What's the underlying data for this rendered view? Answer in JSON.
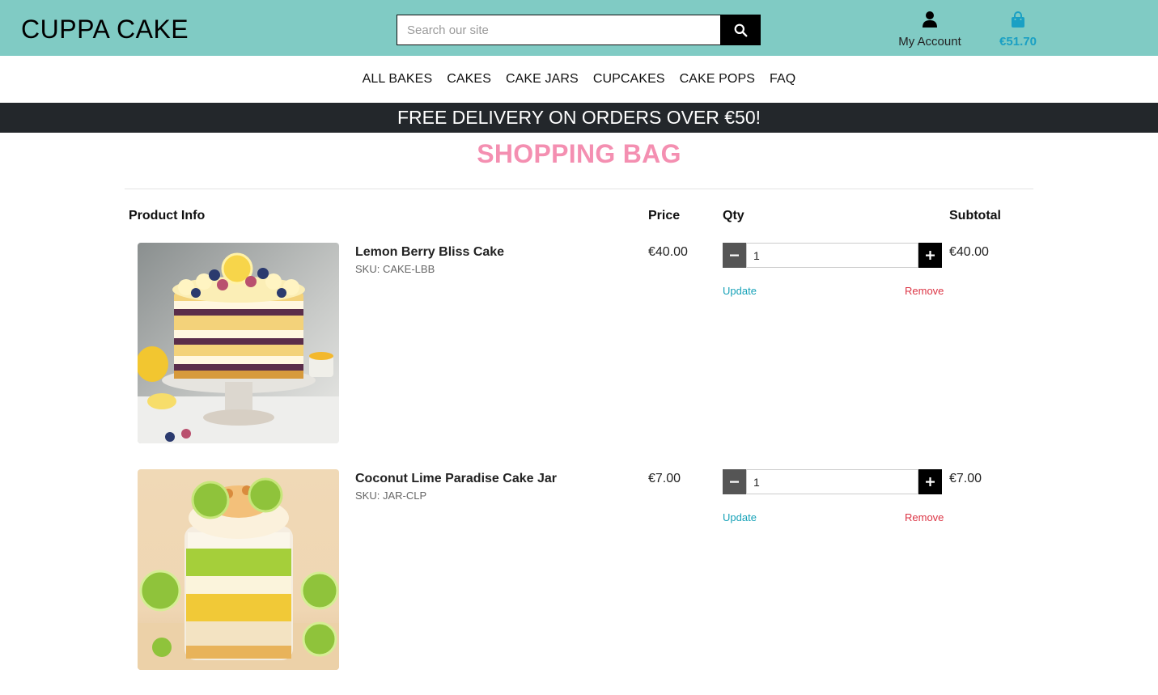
{
  "header": {
    "logo": "CUPPA CAKE",
    "search_placeholder": "Search our site",
    "account_label": "My Account",
    "bag_total": "€51.70"
  },
  "nav": {
    "items": [
      "ALL BAKES",
      "CAKES",
      "CAKE JARS",
      "CUPCAKES",
      "CAKE POPS",
      "FAQ"
    ]
  },
  "banner": {
    "text": "FREE DELIVERY ON ORDERS OVER €50!"
  },
  "page": {
    "title": "SHOPPING BAG"
  },
  "table": {
    "headers": {
      "product_info": "Product Info",
      "price": "Price",
      "qty": "Qty",
      "subtotal": "Subtotal"
    },
    "rows": [
      {
        "name": "Lemon Berry Bliss Cake",
        "sku": "SKU: CAKE-LBB",
        "price": "€40.00",
        "qty": "1",
        "update": "Update",
        "remove": "Remove",
        "subtotal": "€40.00"
      },
      {
        "name": "Coconut Lime Paradise Cake Jar",
        "sku": "SKU: JAR-CLP",
        "price": "€7.00",
        "qty": "1",
        "update": "Update",
        "remove": "Remove",
        "subtotal": "€7.00"
      }
    ]
  },
  "colors": {
    "header_bg": "#80cbc4",
    "banner_bg": "#23272b",
    "title": "#f48fb1",
    "bag_total": "#1aa0c4",
    "update_link": "#17a2b8",
    "remove_link": "#dc3545"
  },
  "icons": {
    "search": "search-icon",
    "account": "user-icon",
    "bag": "shopping-bag-icon",
    "minus": "minus-icon",
    "plus": "plus-icon"
  }
}
